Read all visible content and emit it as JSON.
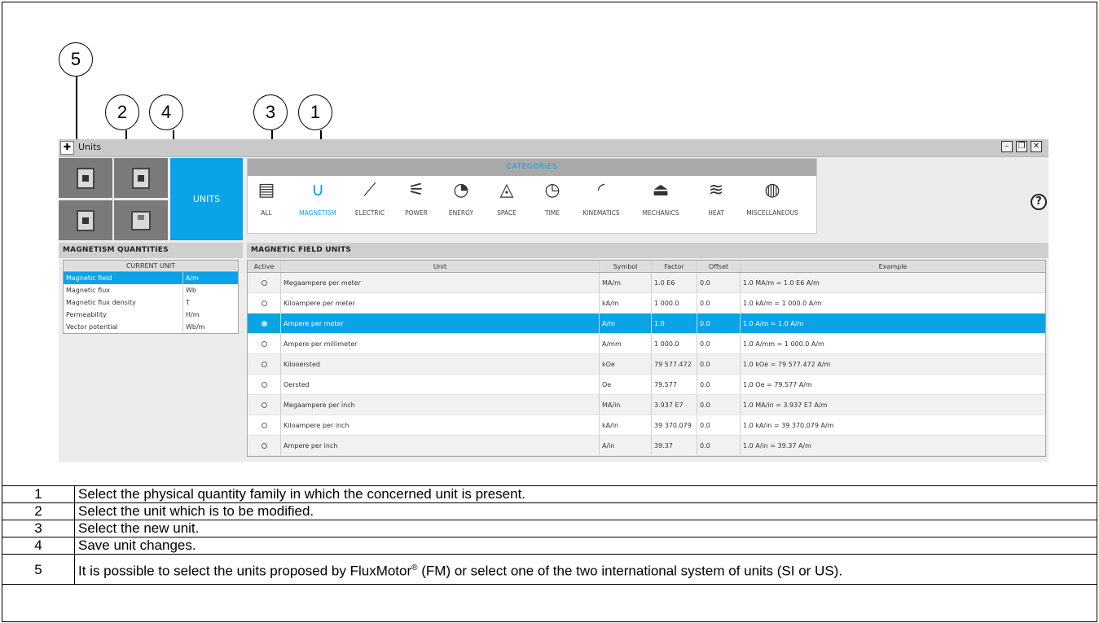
{
  "callouts": [
    {
      "number": "1"
    },
    {
      "number": "2"
    },
    {
      "number": "3"
    },
    {
      "number": "4"
    },
    {
      "number": "5"
    }
  ],
  "window": {
    "title": "Units",
    "controls": [
      "minimize-icon",
      "restore-icon",
      "close-icon"
    ]
  },
  "toolbar": {
    "units_label": "UNITS",
    "tiles": [
      "ruler-fm-icon",
      "ruler-si-icon",
      "ruler-us-icon",
      "save-icon"
    ]
  },
  "categories": {
    "header": "CATEGORIES",
    "items": [
      {
        "label": "ALL",
        "icon": "ruler-icon",
        "active": false
      },
      {
        "label": "MAGNETISM",
        "icon": "magnet-icon",
        "active": true
      },
      {
        "label": "ELECTRIC",
        "icon": "electric-probe-icon",
        "active": false
      },
      {
        "label": "POWER",
        "icon": "plug-icon",
        "active": false
      },
      {
        "label": "ENERGY",
        "icon": "gauge-icon",
        "active": false
      },
      {
        "label": "SPACE",
        "icon": "geometry-icon",
        "active": false
      },
      {
        "label": "TIME",
        "icon": "stopwatch-icon",
        "active": false
      },
      {
        "label": "KINEMATICS",
        "icon": "arc-icon",
        "active": false
      },
      {
        "label": "MECHANICS",
        "icon": "weight-icon",
        "active": false
      },
      {
        "label": "HEAT",
        "icon": "heat-waves-icon",
        "active": false
      },
      {
        "label": "MISCELLANEOUS",
        "icon": "money-bag-icon",
        "active": false
      }
    ],
    "help_icon": "help-icon"
  },
  "quantities": {
    "header": "MAGNETISM QUANTITIES",
    "column": "CURRENT UNIT",
    "rows": [
      {
        "name": "Magnetic field",
        "unit": "A/m",
        "selected": true
      },
      {
        "name": "Magnetic flux",
        "unit": "Wb",
        "selected": false
      },
      {
        "name": "Magnetic flux density",
        "unit": "T",
        "selected": false
      },
      {
        "name": "Permeability",
        "unit": "H/m",
        "selected": false
      },
      {
        "name": "Vector potential",
        "unit": "Wb/m",
        "selected": false
      }
    ]
  },
  "units": {
    "header": "MAGNETIC FIELD UNITS",
    "columns": [
      "Active",
      "Unit",
      "Symbol",
      "Factor",
      "Offset",
      "Example"
    ],
    "rows": [
      {
        "unit": "Megaampere per meter",
        "symbol": "MA/m",
        "factor": "1.0 E6",
        "offset": "0.0",
        "example": "1.0 MA/m = 1.0 E6 A/m",
        "active": false
      },
      {
        "unit": "Kiloampere per meter",
        "symbol": "kA/m",
        "factor": "1 000.0",
        "offset": "0.0",
        "example": "1.0 kA/m = 1 000.0 A/m",
        "active": false
      },
      {
        "unit": "Ampere per meter",
        "symbol": "A/m",
        "factor": "1.0",
        "offset": "0.0",
        "example": "1.0 A/m = 1.0 A/m",
        "active": true
      },
      {
        "unit": "Ampere per millimeter",
        "symbol": "A/mm",
        "factor": "1 000.0",
        "offset": "0.0",
        "example": "1.0 A/mm = 1 000.0 A/m",
        "active": false
      },
      {
        "unit": "Kilooersted",
        "symbol": "kOe",
        "factor": "79 577.472",
        "offset": "0.0",
        "example": "1.0 kOe = 79 577.472 A/m",
        "active": false
      },
      {
        "unit": "Oersted",
        "symbol": "Oe",
        "factor": "79.577",
        "offset": "0.0",
        "example": "1.0 Oe = 79.577 A/m",
        "active": false
      },
      {
        "unit": "Megaampere per inch",
        "symbol": "MA/in",
        "factor": "3.937 E7",
        "offset": "0.0",
        "example": "1.0 MA/in = 3.937 E7 A/m",
        "active": false
      },
      {
        "unit": "Kiloampere per inch",
        "symbol": "kA/in",
        "factor": "39 370.079",
        "offset": "0.0",
        "example": "1.0 kA/in = 39 370.079 A/m",
        "active": false
      },
      {
        "unit": "Ampere per inch",
        "symbol": "A/in",
        "factor": "39.37",
        "offset": "0.0",
        "example": "1.0 A/in = 39.37 A/m",
        "active": false
      }
    ]
  },
  "legend": [
    {
      "num": "1",
      "text": "Select the physical quantity family in which the concerned unit is present."
    },
    {
      "num": "2",
      "text": "Select the unit which is to be modified."
    },
    {
      "num": "3",
      "text": "Select the new unit."
    },
    {
      "num": "4",
      "text": "Save unit changes."
    },
    {
      "num": "5",
      "text_before": "It is possible to select the units proposed by FluxMotor",
      "reg": "®",
      "text_after": " (FM) or select one of the two international system of units (SI or US)."
    }
  ],
  "colors": {
    "accent": "#0aa3e8",
    "tile": "#7a7a7a",
    "header": "#a9a9a9"
  }
}
